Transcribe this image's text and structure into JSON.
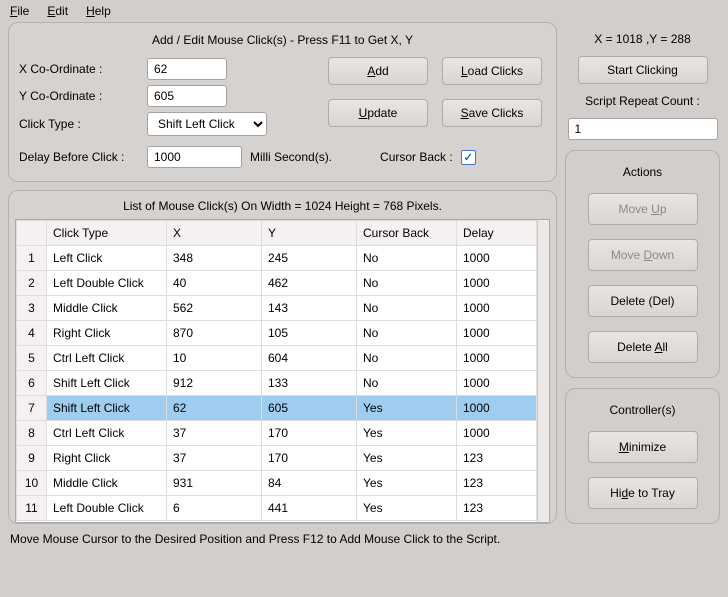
{
  "menu": {
    "file": "File",
    "edit": "Edit",
    "help": "Help"
  },
  "form": {
    "title": "Add / Edit Mouse Click(s) - Press F11 to Get X, Y",
    "x_label": "X Co-Ordinate :",
    "y_label": "Y Co-Ordinate :",
    "click_type_label": "Click Type :",
    "delay_label": "Delay Before Click :",
    "x_value": "62",
    "y_value": "605",
    "click_type_value": "Shift Left Click",
    "delay_value": "1000",
    "ms_label": "Milli Second(s).",
    "cursor_back_label": "Cursor Back :",
    "cursor_back_checked": "✓",
    "add_btn": "Add",
    "load_btn": "Load Clicks",
    "update_btn": "Update",
    "save_btn": "Save Clicks"
  },
  "right": {
    "coords": "X = 1018 ,Y = 288",
    "start_btn": "Start Clicking",
    "repeat_label": "Script Repeat Count :",
    "repeat_value": "1",
    "actions_head": "Actions",
    "move_up": "Move Up",
    "move_down": "Move Down",
    "delete_del": "Delete (Del)",
    "delete_all": "Delete All",
    "controllers_head": "Controller(s)",
    "minimize": "Minimize",
    "hide_tray": "Hide to Tray"
  },
  "table": {
    "title": "List of Mouse Click(s) On Width = 1024 Height = 768 Pixels.",
    "headers": {
      "click_type": "Click Type",
      "x": "X",
      "y": "Y",
      "cursor_back": "Cursor Back",
      "delay": "Delay"
    },
    "selected_index": 6,
    "rows": [
      {
        "n": "1",
        "type": "Left Click",
        "x": "348",
        "y": "245",
        "cb": "No",
        "d": "1000"
      },
      {
        "n": "2",
        "type": "Left Double Click",
        "x": "40",
        "y": "462",
        "cb": "No",
        "d": "1000"
      },
      {
        "n": "3",
        "type": "Middle Click",
        "x": "562",
        "y": "143",
        "cb": "No",
        "d": "1000"
      },
      {
        "n": "4",
        "type": "Right Click",
        "x": "870",
        "y": "105",
        "cb": "No",
        "d": "1000"
      },
      {
        "n": "5",
        "type": "Ctrl Left Click",
        "x": "10",
        "y": "604",
        "cb": "No",
        "d": "1000"
      },
      {
        "n": "6",
        "type": "Shift Left Click",
        "x": "912",
        "y": "133",
        "cb": "No",
        "d": "1000"
      },
      {
        "n": "7",
        "type": "Shift Left Click",
        "x": "62",
        "y": "605",
        "cb": "Yes",
        "d": "1000"
      },
      {
        "n": "8",
        "type": "Ctrl Left Click",
        "x": "37",
        "y": "170",
        "cb": "Yes",
        "d": "1000"
      },
      {
        "n": "9",
        "type": "Right Click",
        "x": "37",
        "y": "170",
        "cb": "Yes",
        "d": "123"
      },
      {
        "n": "10",
        "type": "Middle Click",
        "x": "931",
        "y": "84",
        "cb": "Yes",
        "d": "123"
      },
      {
        "n": "11",
        "type": "Left Double Click",
        "x": "6",
        "y": "441",
        "cb": "Yes",
        "d": "123"
      }
    ]
  },
  "status": "Move Mouse Cursor to the Desired Position and Press F12 to Add Mouse Click to the Script."
}
